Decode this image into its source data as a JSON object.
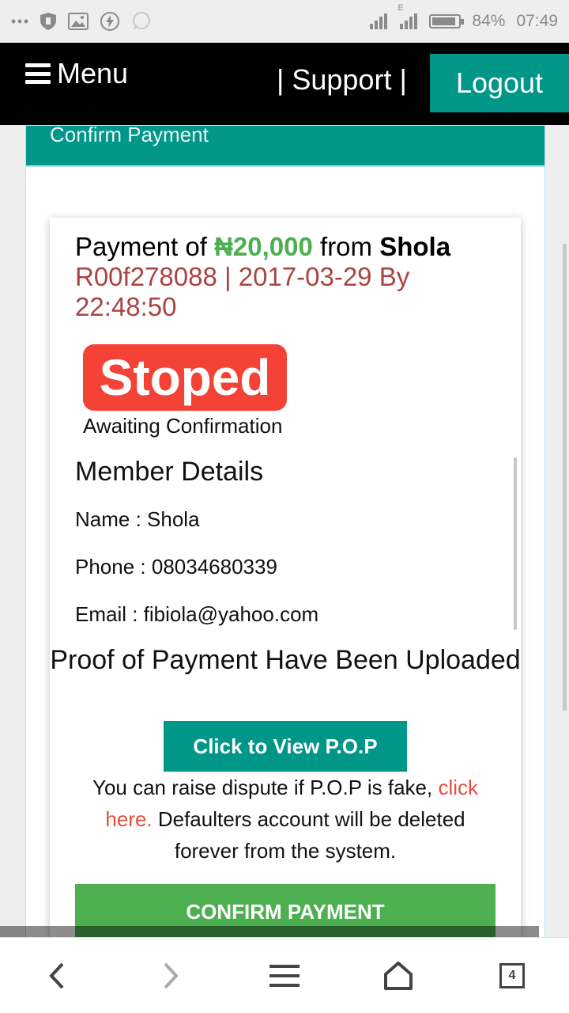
{
  "status_bar": {
    "battery": "84%",
    "time": "07:49",
    "network_label": "E",
    "icons": [
      "more-dots-icon",
      "shield-icon",
      "image-icon",
      "flash-icon",
      "whatsapp-icon",
      "signal-icon",
      "battery-icon"
    ]
  },
  "nav": {
    "menu_label": "Menu",
    "support_label": "| Support |",
    "logout_label": "Logout"
  },
  "panel": {
    "header_title": "Confirm Payment"
  },
  "payment": {
    "prefix": "Payment of ",
    "amount": "₦20,000",
    "from_text": " from ",
    "name": "Shola",
    "ref_line": "R00f278088 | 2017-03-29 By 22:48:50",
    "status_badge": "Stoped",
    "status_sub": "Awaiting Confirmation"
  },
  "member": {
    "title": "Member Details",
    "name": "Name : Shola",
    "phone": "Phone : 08034680339",
    "email": "Email : fibiola@yahoo.com"
  },
  "pop": {
    "title": "Proof of Payment Have Been Uploaded",
    "view_button": "Click to View P.O.P",
    "dispute_pre": "You can raise dispute if P.O.P is fake, ",
    "dispute_link": "click here.",
    "dispute_post": " Defaulters account will be deleted forever from the system."
  },
  "actions": {
    "confirm_button": "CONFIRM PAYMENT"
  },
  "browser_bar": {
    "tab_count": "4",
    "icons": [
      "back-icon",
      "forward-icon",
      "menu-icon",
      "home-icon",
      "tabs-icon"
    ]
  },
  "colors": {
    "teal": "#009688",
    "green": "#4caf50",
    "red_badge": "#f44336",
    "ref_text": "#a94442",
    "link": "#e74c3c"
  }
}
